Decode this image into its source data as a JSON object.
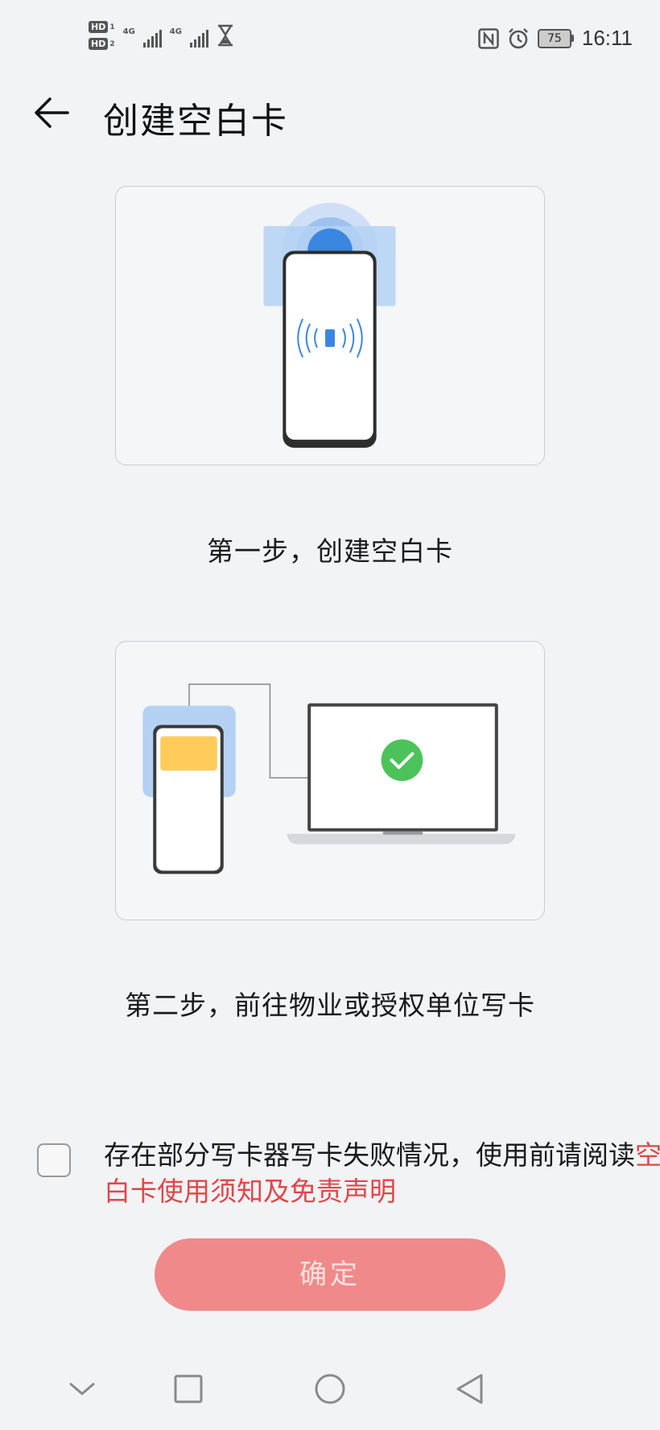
{
  "status_bar": {
    "sim1_label": "HD",
    "sim1_index": "1",
    "sim2_label": "HD",
    "sim2_index": "2",
    "network1": "4G",
    "network2": "4G",
    "battery_level": "75",
    "time": "16:11",
    "icons": [
      "nfc-icon",
      "alarm-icon",
      "hourglass-icon",
      "battery-icon"
    ]
  },
  "header": {
    "title": "创建空白卡",
    "back_icon": "arrow-left-icon"
  },
  "steps": [
    {
      "label": "第一步，创建空白卡",
      "illustration": "phone-tap-card"
    },
    {
      "label": "第二步，前往物业或授权单位写卡",
      "illustration": "phone-laptop-check"
    }
  ],
  "agreement": {
    "checked": false,
    "text": "存在部分写卡器写卡失败情况，使用前请阅读",
    "link": "空白卡使用须知及免责声明"
  },
  "confirm_button": {
    "label": "确定",
    "enabled": false
  },
  "nav_bar": {
    "icons": [
      "chevron-down-icon",
      "square-icon",
      "circle-icon",
      "triangle-back-icon"
    ]
  },
  "colors": {
    "accent_red": "#e0474a",
    "button_disabled": "#f08a8a",
    "check_green": "#4cc35a",
    "card_yellow": "#ffcc5c",
    "nfc_blue": "#4a90e2"
  }
}
